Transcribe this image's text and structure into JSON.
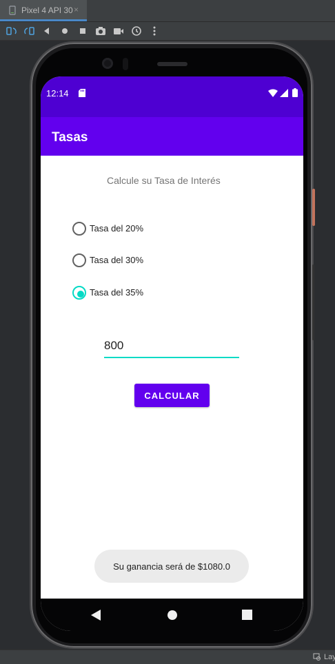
{
  "ide": {
    "tab_label": "Pixel 4 API 30",
    "tab_close": "×",
    "status_label": "Lay",
    "toolbar_icons": [
      "rotate-left-icon",
      "rotate-right-icon",
      "back-icon",
      "home-icon",
      "overview-icon",
      "screenshot-icon",
      "screen-record-icon",
      "snapshot-icon",
      "more-icon"
    ]
  },
  "device": {
    "status_bar": {
      "time": "12:14",
      "icons": [
        "sd-card-icon",
        "wifi-icon",
        "signal-icon",
        "battery-icon"
      ]
    },
    "app_bar": {
      "title": "Tasas"
    },
    "main": {
      "heading": "Calcule su Tasa de Interés",
      "radio_options": [
        {
          "label": "Tasa del 20%",
          "checked": false
        },
        {
          "label": "Tasa del 30%",
          "checked": false
        },
        {
          "label": "Tasa del 35%",
          "checked": true
        }
      ],
      "amount_value": "800",
      "calculate_button": "CALCULAR"
    },
    "toast": {
      "message": "Su ganancia será de $1080.0"
    },
    "nav_bar": {
      "icons": [
        "nav-back-icon",
        "nav-home-icon",
        "nav-recents-icon"
      ]
    }
  },
  "colors": {
    "primary": "#6200ee",
    "primary_dark": "#4e00d2",
    "accent": "#03dac5",
    "toast_bg": "#ebebeb",
    "ide_bg": "#3c3f41",
    "emulator_bg": "#2b2d30"
  }
}
